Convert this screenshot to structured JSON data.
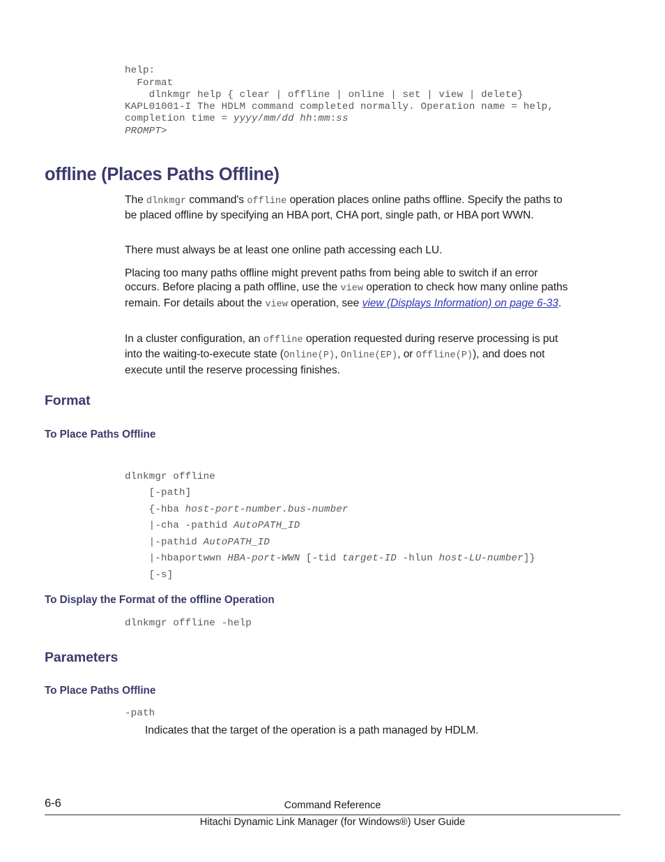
{
  "document": {
    "page_number": "6-6",
    "footer_section": "Command Reference",
    "footer_title": "Hitachi Dynamic Link Manager (for Windows®) User Guide"
  },
  "top_code_block": {
    "lines": [
      "help:",
      "  Format",
      "    dlnkmgr help { clear | offline | online | set | view | delete}",
      "KAPL01001-I The HDLM command completed normally. Operation name = help, completion time = yyyy/mm/dd hh:mm:ss",
      "PROMPT>"
    ],
    "line1": "help:",
    "line2": "  Format",
    "line3": "    dlnkmgr help { clear | offline | online | set | view | delete}",
    "line4_plain_a": "KAPL01001-I The HDLM command completed normally. Operation name = help, completion time = ",
    "line4_italic_a": "yyyy",
    "line4_plain_b": "/",
    "line4_italic_b": "mm",
    "line4_plain_c": "/",
    "line4_italic_c": "dd",
    "line4_plain_d": " ",
    "line4_italic_d": "hh",
    "line4_plain_e": ":",
    "line4_italic_e": "mm",
    "line4_plain_f": ":",
    "line4_italic_f": "ss",
    "line5": "PROMPT>"
  },
  "main_heading": "offline (Places Paths Offline)",
  "intro": {
    "p1_a": "The ",
    "p1_code1": "dlnkmgr",
    "p1_b": " command's ",
    "p1_code2": "offline",
    "p1_c": " operation places online paths offline. Specify the paths to be placed offline by specifying an HBA port, CHA port, single path, or HBA port WWN.",
    "p2": "There must always be at least one online path accessing each LU.",
    "p3_a": "Placing too many paths offline might prevent paths from being able to switch if an error occurs. Before placing a path offline, use the ",
    "p3_code1": "view",
    "p3_b": " operation to check how many online paths remain. For details about the ",
    "p3_code2": "view",
    "p3_c": " operation, see ",
    "p3_link": "view (Displays Information) on page 6-33",
    "p3_d": ".",
    "p4_a": "In a cluster configuration, an ",
    "p4_code1": "offline",
    "p4_b": " operation requested during reserve processing is put into the waiting-to-execute state (",
    "p4_code2": "Online(P)",
    "p4_c": ", ",
    "p4_code3": "Online(EP)",
    "p4_d": ", or ",
    "p4_code4": "Offline(P)",
    "p4_e": "), and does not execute until the reserve processing finishes."
  },
  "format_section": {
    "heading": "Format",
    "sub1_heading": "To Place Paths Offline",
    "sub1_code": {
      "l1": "dlnkmgr offline",
      "l2": "    [-path]",
      "l3_plain": "    {-hba ",
      "l3_ital": "host-port-number.bus-number",
      "l4_plain": "    |-cha -pathid ",
      "l4_ital": "AutoPATH_ID",
      "l5_plain": "    |-pathid ",
      "l5_ital": "AutoPATH_ID",
      "l6_plain_a": "    |-hbaportwwn ",
      "l6_ital_a": "HBA-port-WWN",
      "l6_plain_b": " [-tid ",
      "l6_ital_b": "target-ID",
      "l6_plain_c": " -hlun ",
      "l6_ital_c": "host-LU-number",
      "l6_plain_d": "]}",
      "l7": "    [-s]"
    },
    "sub2_heading": "To Display the Format of the offline Operation",
    "sub2_code": "dlnkmgr offline -help"
  },
  "parameters_section": {
    "heading": "Parameters",
    "sub1_heading": "To Place Paths Offline",
    "param_name": "-path",
    "param_desc": "Indicates that the target of the operation is a path managed by HDLM."
  },
  "colors": {
    "heading": "#3b3b6d",
    "link": "#3333b8",
    "code": "#575757",
    "body": "#1c1c1c"
  }
}
